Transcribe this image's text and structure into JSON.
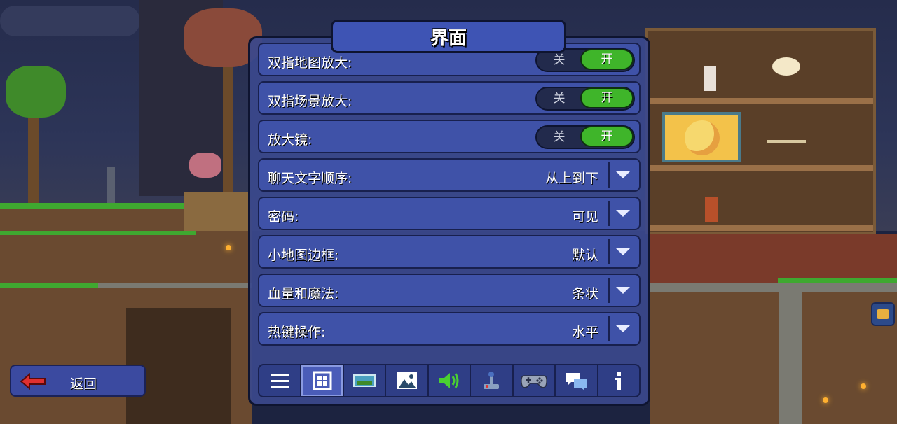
{
  "panel": {
    "title": "界面",
    "rows": [
      {
        "label": "双指地图放大:",
        "type": "toggle",
        "off_label": "关",
        "on_label": "开",
        "state": "on"
      },
      {
        "label": "双指场景放大:",
        "type": "toggle",
        "off_label": "关",
        "on_label": "开",
        "state": "on"
      },
      {
        "label": "放大镜:",
        "type": "toggle",
        "off_label": "关",
        "on_label": "开",
        "state": "on"
      },
      {
        "label": "聊天文字顺序:",
        "type": "dropdown",
        "value": "从上到下"
      },
      {
        "label": "密码:",
        "type": "dropdown",
        "value": "可见"
      },
      {
        "label": "小地图边框:",
        "type": "dropdown",
        "value": "默认"
      },
      {
        "label": "血量和魔法:",
        "type": "dropdown",
        "value": "条状"
      },
      {
        "label": "热键操作:",
        "type": "dropdown",
        "value": "水平"
      }
    ],
    "tabs": [
      {
        "icon": "menu-icon",
        "active": false
      },
      {
        "icon": "interface-icon",
        "active": true
      },
      {
        "icon": "video-icon",
        "active": false
      },
      {
        "icon": "image-icon",
        "active": false
      },
      {
        "icon": "audio-icon",
        "active": false
      },
      {
        "icon": "joystick-icon",
        "active": false
      },
      {
        "icon": "gamepad-icon",
        "active": false
      },
      {
        "icon": "chat-icon",
        "active": false
      },
      {
        "icon": "info-icon",
        "active": false
      }
    ]
  },
  "back_button": {
    "label": "返回",
    "icon": "back-arrow-icon"
  },
  "colors": {
    "panel": "#3a488c",
    "row": "#3f52a8",
    "toggle_on": "#3fb52a",
    "back_arrow": "#e03030"
  }
}
